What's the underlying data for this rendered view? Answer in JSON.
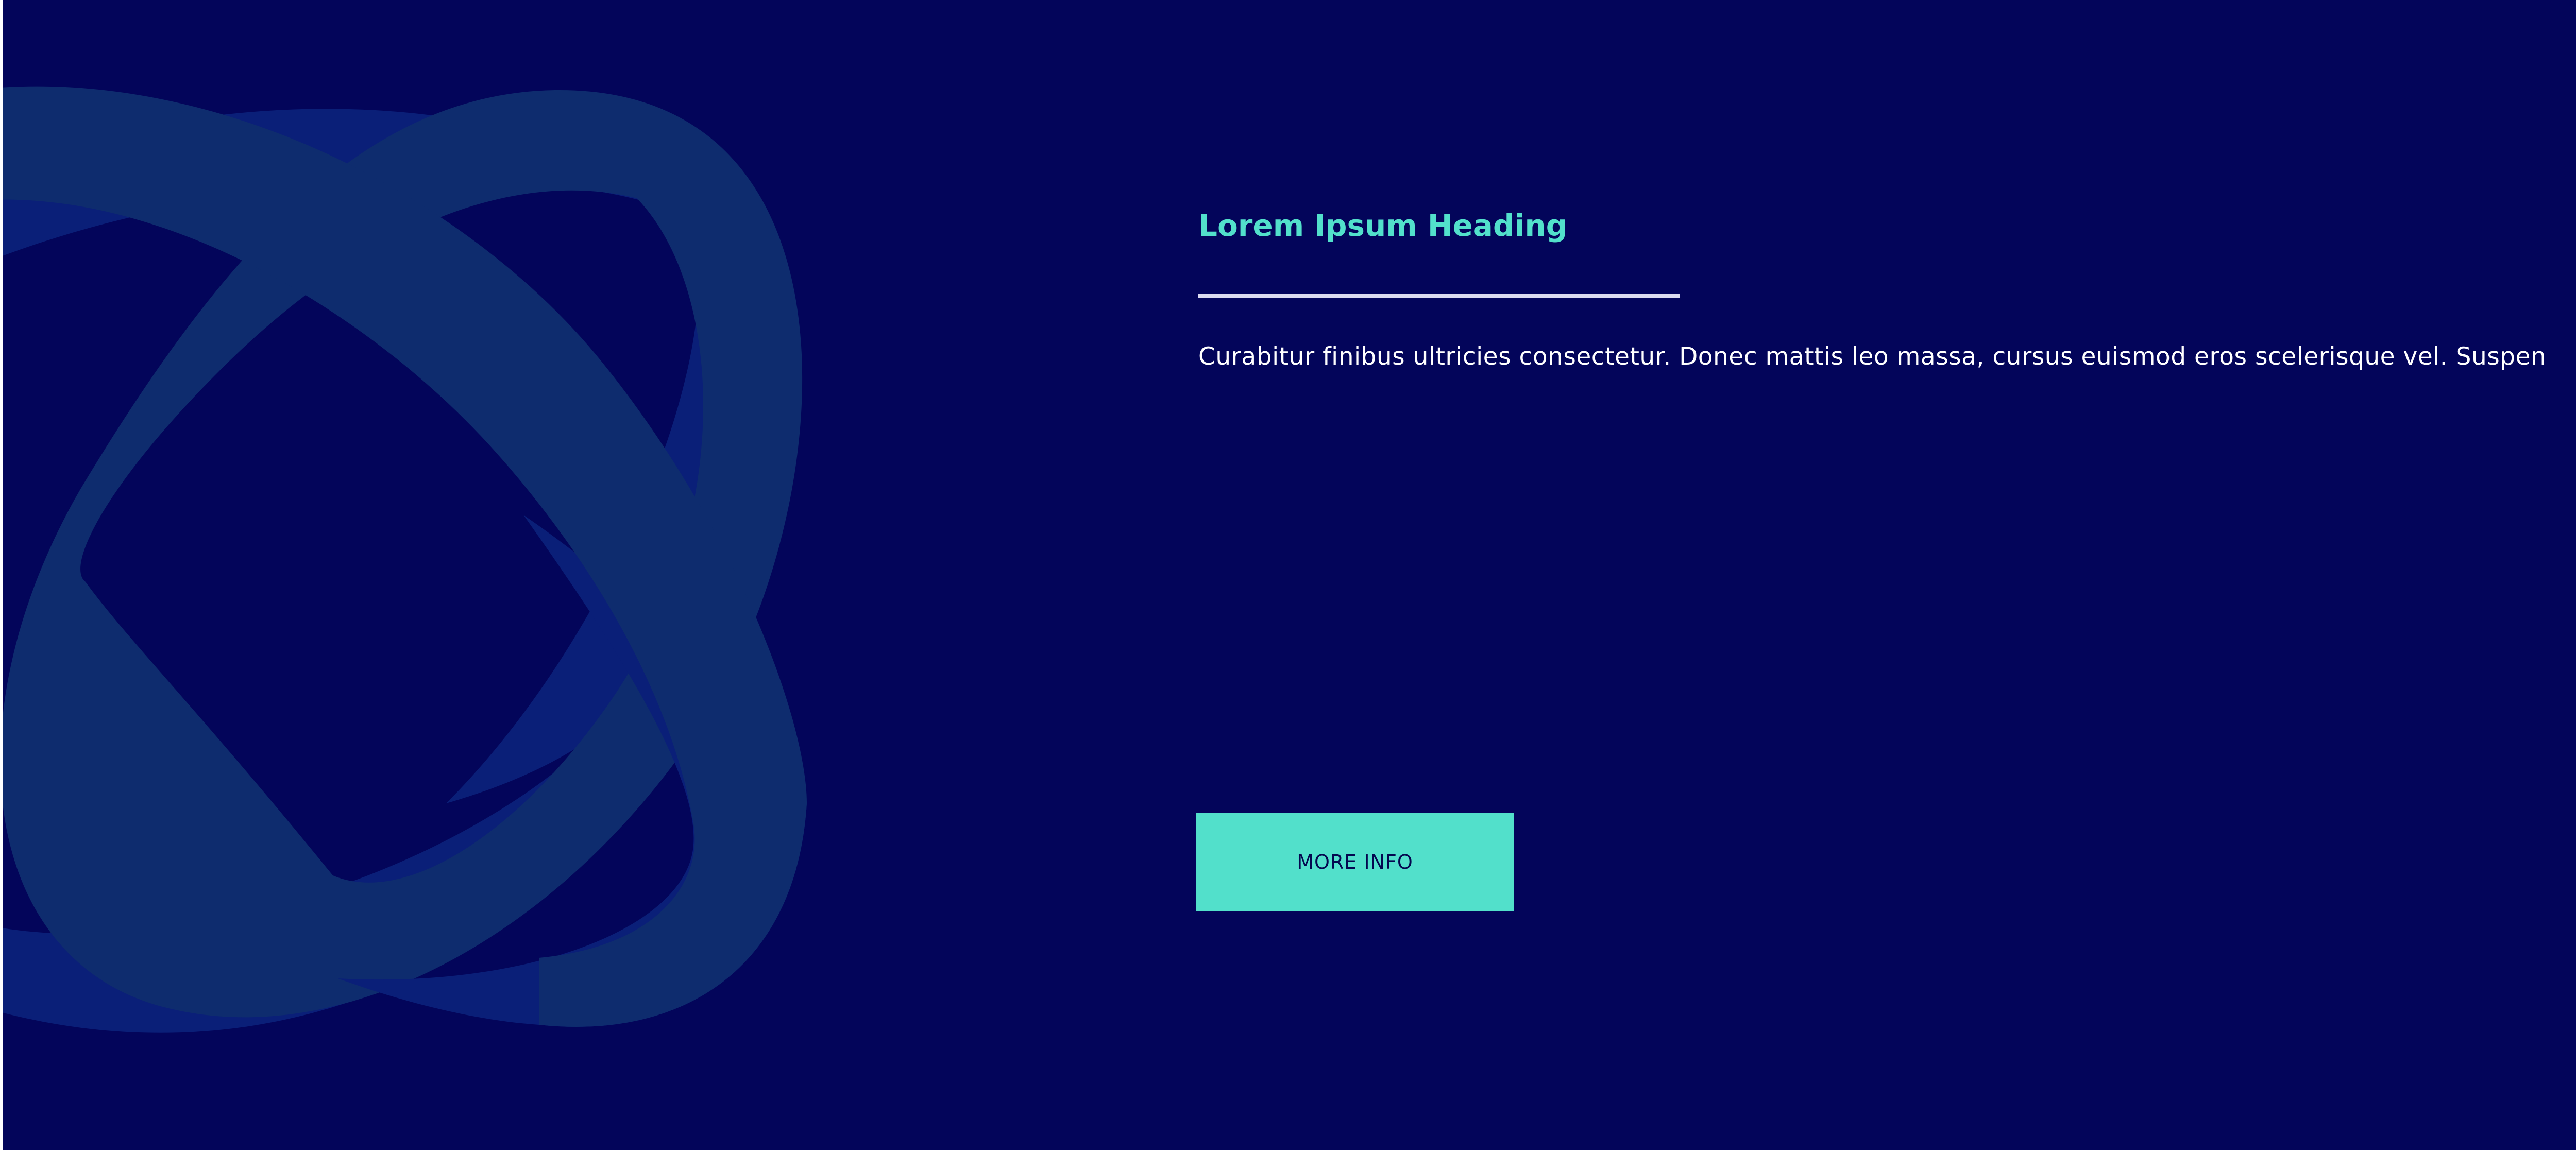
{
  "colors": {
    "background": "#03055a",
    "accent": "#52e0cb",
    "heading": "#52e0cb",
    "body_text": "#ffffff",
    "divider": "#dcdcf0",
    "button_text": "#04074f",
    "ring_front": "#0e2c6e",
    "ring_back": "#0a1f78"
  },
  "hero": {
    "decoration_icon": "interlocking-rings-icon",
    "heading": "Lorem Ipsum Heading",
    "body": "Curabitur finibus ultricies consectetur. Donec mattis leo massa, cursus euismod eros scelerisque vel. Suspen",
    "button_label": "MORE INFO"
  }
}
